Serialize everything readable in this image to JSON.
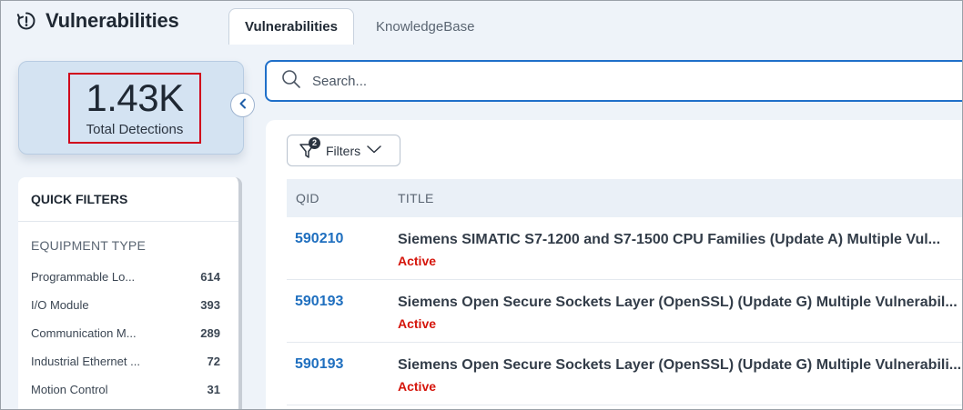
{
  "app": {
    "title": "Vulnerabilities",
    "icon": "alert-clock-icon"
  },
  "tabs": [
    {
      "label": "Vulnerabilities",
      "active": true
    },
    {
      "label": "KnowledgeBase",
      "active": false
    }
  ],
  "summary": {
    "value": "1.43K",
    "label": "Total Detections"
  },
  "quick_filters": {
    "title": "QUICK FILTERS",
    "section": "EQUIPMENT TYPE",
    "items": [
      {
        "label": "Programmable Lo...",
        "count": "614"
      },
      {
        "label": "I/O Module",
        "count": "393"
      },
      {
        "label": "Communication M...",
        "count": "289"
      },
      {
        "label": "Industrial Ethernet ...",
        "count": "72"
      },
      {
        "label": "Motion Control",
        "count": "31"
      }
    ]
  },
  "search": {
    "placeholder": "Search...",
    "value": ""
  },
  "filters": {
    "label": "Filters",
    "badge": "2"
  },
  "table": {
    "columns": {
      "qid": "QID",
      "title": "TITLE"
    },
    "rows": [
      {
        "qid": "590210",
        "title": "Siemens SIMATIC S7-1200 and S7-1500 CPU Families (Update A) Multiple Vul...",
        "status": "Active"
      },
      {
        "qid": "590193",
        "title": "Siemens Open Secure Sockets Layer (OpenSSL) (Update G) Multiple Vulnerabil...",
        "status": "Active"
      },
      {
        "qid": "590193",
        "title": "Siemens Open Secure Sockets Layer (OpenSSL) (Update G) Multiple Vulnerabili...",
        "status": "Active"
      }
    ]
  },
  "colors": {
    "accent": "#1f6fc9",
    "qid": "#1f6fbf",
    "status_active": "#d5150b",
    "highlight_border": "#d0021b"
  }
}
